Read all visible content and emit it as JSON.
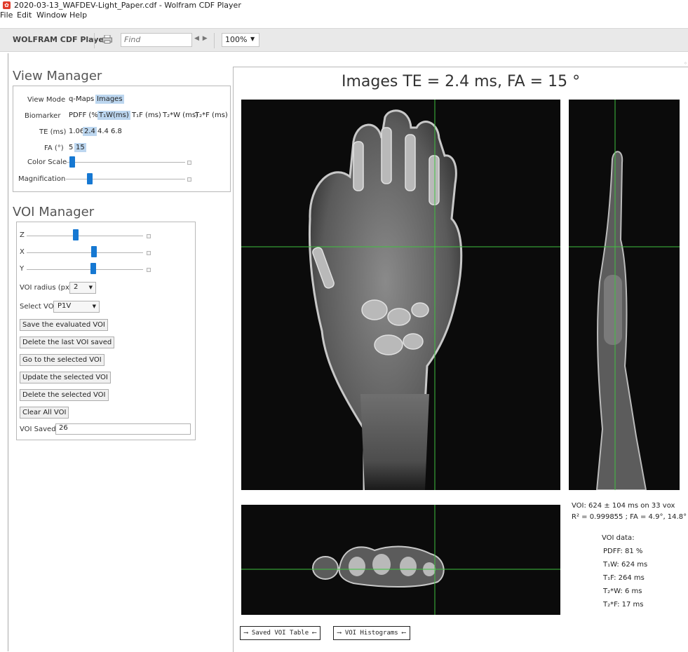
{
  "window": {
    "title": "2020-03-13_WAFDEV-Light_Paper.cdf - Wolfram CDF Player",
    "icon_color": "#e03b2a"
  },
  "menu": [
    "File",
    "Edit",
    "Window",
    "Help"
  ],
  "toolbar": {
    "app_name": "WOLFRAM CDF Player",
    "find_placeholder": "Find",
    "find_arrows": "◀ ▶",
    "zoom": "100%"
  },
  "view_manager": {
    "heading": "View Manager",
    "view_mode": {
      "label": "View Mode",
      "options": [
        "q-Maps",
        "Images"
      ],
      "selected": "Images"
    },
    "biomarker": {
      "label": "Biomarker",
      "options": [
        "PDFF (%)",
        "T₁W(ms)",
        "T₁F (ms)",
        "T₂*W (ms)",
        "T₂*F (ms)"
      ],
      "selected": "T₁W(ms)"
    },
    "te": {
      "label": "TE (ms)",
      "options": [
        "1.06",
        "2.4",
        "4.4",
        "6.8"
      ],
      "selected": "2.4"
    },
    "fa": {
      "label": "FA (°)",
      "options": [
        "5",
        "15"
      ],
      "selected": "15"
    },
    "color_scale": {
      "label": "Color Scale",
      "value": 0.05
    },
    "magnification": {
      "label": "Magnification",
      "value": 0.2
    }
  },
  "voi_manager": {
    "heading": "VOI Manager",
    "sliders": [
      {
        "label": "Z",
        "value": 0.42
      },
      {
        "label": "X",
        "value": 0.58
      },
      {
        "label": "Y",
        "value": 0.57
      }
    ],
    "voi_radius": {
      "label": "VOI radius (px)",
      "value": "2"
    },
    "select_voi": {
      "label": "Select VOI",
      "value": "P1V"
    },
    "buttons": [
      "Save the evaluated VOI",
      "Delete the last VOI saved",
      "Go to the selected VOI",
      "Update the selected VOI",
      "Delete the selected VOI",
      "Clear All VOI"
    ],
    "voi_saved": {
      "label": "VOI Saved",
      "value": "26"
    }
  },
  "viewer": {
    "title": "Images TE = 2.4 ms, FA = 15 °",
    "crosshair_color": "#3fc23f",
    "voi_summary": [
      "VOI: 624 ± 104 ms on 33 vox",
      "R² = 0.999855 ; FA = 4.9°, 14.8°"
    ],
    "voi_data_title": "VOI data:",
    "voi_data": [
      "PDFF: 81 %",
      "T₁W: 624 ms",
      "T₁F: 264 ms",
      "T₂*W: 6 ms",
      "T₂*F: 17 ms"
    ],
    "tabs": [
      "⟶ Saved VOI Table ⟵",
      "⟶ VOI Histograms ⟵"
    ]
  }
}
